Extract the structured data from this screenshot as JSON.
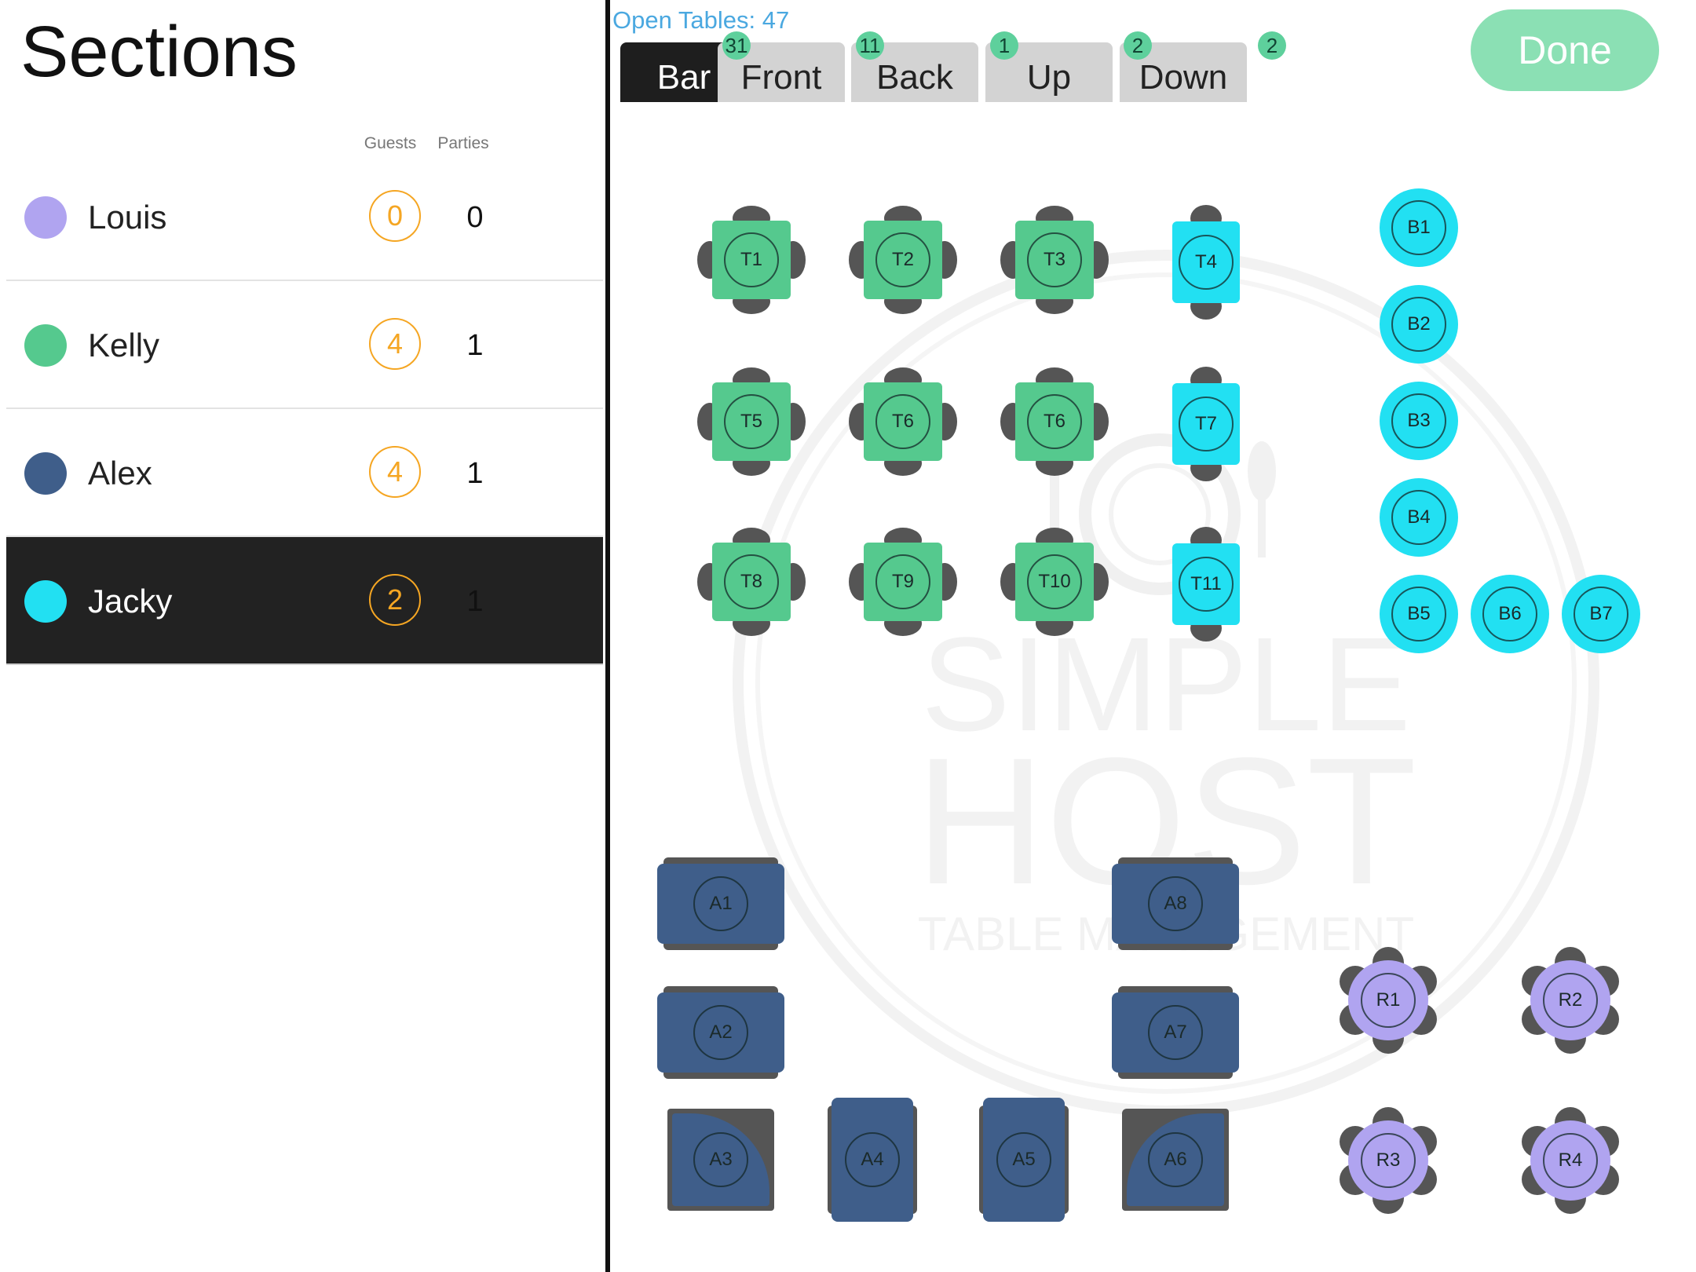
{
  "sections_panel": {
    "title": "Sections",
    "col_guests": "Guests",
    "col_parties": "Parties",
    "items": [
      {
        "name": "Louis",
        "guests": "0",
        "parties": "0",
        "color": "#b0a4f0",
        "selected": false
      },
      {
        "name": "Kelly",
        "guests": "4",
        "parties": "1",
        "color": "#55c98e",
        "selected": false
      },
      {
        "name": "Alex",
        "guests": "4",
        "parties": "1",
        "color": "#3f5e8a",
        "selected": false
      },
      {
        "name": "Jacky",
        "guests": "2",
        "parties": "1",
        "color": "#22e0f2",
        "selected": true
      }
    ]
  },
  "floor": {
    "open_tables": "Open Tables: 47",
    "done_label": "Done",
    "tabs": [
      {
        "label": "Bar",
        "count": "31",
        "active": true
      },
      {
        "label": "Front",
        "count": "11",
        "active": false
      },
      {
        "label": "Back",
        "count": "1",
        "active": false
      },
      {
        "label": "Up",
        "count": "2",
        "active": false
      },
      {
        "label": "Down",
        "count": "2",
        "active": false
      }
    ],
    "watermark": {
      "line1": "SIMPLE",
      "line2": "HOST",
      "line3": "TABLE MANAGEMENT"
    },
    "colors": {
      "kelly": "#55c98e",
      "jacky": "#22e0f2",
      "alex": "#3f5e8a",
      "louis": "#b0a4f0",
      "chair": "#555555",
      "badge": "#5ed09c",
      "done": "#8be0b4",
      "guests_ring": "#f5a623",
      "open_tables_text": "#4aa8e0"
    },
    "tables": [
      {
        "label": "T1",
        "section": "kelly"
      },
      {
        "label": "T2",
        "section": "kelly"
      },
      {
        "label": "T3",
        "section": "kelly"
      },
      {
        "label": "T4",
        "section": "jacky"
      },
      {
        "label": "T5",
        "section": "kelly"
      },
      {
        "label": "T6",
        "section": "kelly"
      },
      {
        "label": "T6",
        "section": "kelly"
      },
      {
        "label": "T7",
        "section": "jacky"
      },
      {
        "label": "T8",
        "section": "kelly"
      },
      {
        "label": "T9",
        "section": "kelly"
      },
      {
        "label": "T10",
        "section": "kelly"
      },
      {
        "label": "T11",
        "section": "jacky"
      },
      {
        "label": "B1",
        "section": "jacky"
      },
      {
        "label": "B2",
        "section": "jacky"
      },
      {
        "label": "B3",
        "section": "jacky"
      },
      {
        "label": "B4",
        "section": "jacky"
      },
      {
        "label": "B5",
        "section": "jacky"
      },
      {
        "label": "B6",
        "section": "jacky"
      },
      {
        "label": "B7",
        "section": "jacky"
      },
      {
        "label": "A1",
        "section": "alex"
      },
      {
        "label": "A2",
        "section": "alex"
      },
      {
        "label": "A3",
        "section": "alex"
      },
      {
        "label": "A4",
        "section": "alex"
      },
      {
        "label": "A5",
        "section": "alex"
      },
      {
        "label": "A6",
        "section": "alex"
      },
      {
        "label": "A7",
        "section": "alex"
      },
      {
        "label": "A8",
        "section": "alex"
      },
      {
        "label": "R1",
        "section": "louis"
      },
      {
        "label": "R2",
        "section": "louis"
      },
      {
        "label": "R3",
        "section": "louis"
      },
      {
        "label": "R4",
        "section": "louis"
      }
    ]
  }
}
